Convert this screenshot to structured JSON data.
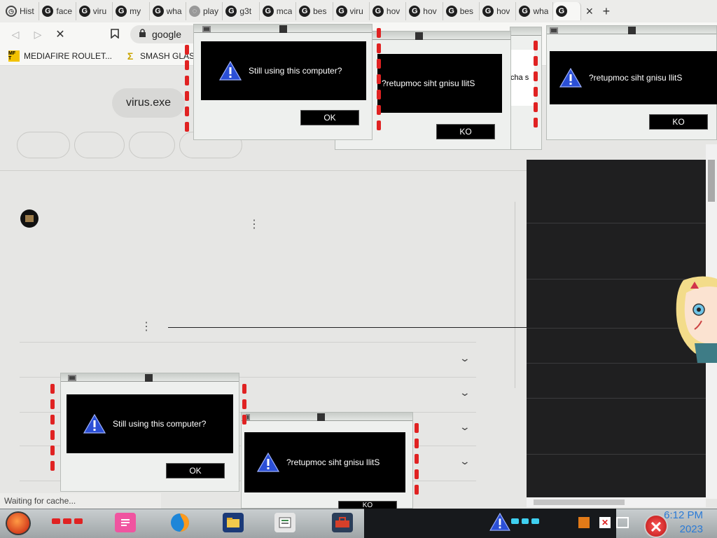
{
  "tabs": [
    {
      "label": "Hist",
      "icon": "history-icon"
    },
    {
      "label": "face",
      "icon": "google-icon"
    },
    {
      "label": "viru",
      "icon": "google-icon"
    },
    {
      "label": "my",
      "icon": "google-icon"
    },
    {
      "label": "wha",
      "icon": "google-icon"
    },
    {
      "label": "play",
      "icon": "loading-icon"
    },
    {
      "label": "g3t",
      "icon": "google-icon"
    },
    {
      "label": "mca",
      "icon": "google-icon"
    },
    {
      "label": "bes",
      "icon": "google-icon"
    },
    {
      "label": "viru",
      "icon": "google-icon"
    },
    {
      "label": "hov",
      "icon": "google-icon"
    },
    {
      "label": "hov",
      "icon": "google-icon"
    },
    {
      "label": "bes",
      "icon": "google-icon"
    },
    {
      "label": "hov",
      "icon": "google-icon"
    },
    {
      "label": "wha",
      "icon": "google-icon"
    }
  ],
  "active_tab": {
    "icon": "google-icon"
  },
  "tab_close": "×",
  "new_tab": "+",
  "toolbar": {
    "back": "◁",
    "forward": "▷",
    "stop": "✕",
    "bookmark": "🔖",
    "url": "google"
  },
  "bookmarks": [
    {
      "label": "MEDIAFIRE ROULET...",
      "badge": "MF T"
    },
    {
      "label": "SMASH GLAS",
      "badge": "Σ"
    }
  ],
  "page": {
    "chip": "virus.exe",
    "kebab": "⋮",
    "chevron": "⌄",
    "status": "Waiting for cache...",
    "partial_text": "cha s"
  },
  "dialogs": {
    "normal_message": "Still using this computer?",
    "mirrored_message": "?retupmoc siht gnisu llitS",
    "ok": "OK",
    "ko": "KO"
  },
  "taskbar": {
    "time": "6:12 PM",
    "year": "2023"
  },
  "colors": {
    "accent_red": "#e02222",
    "clock_blue": "#2a7ad6",
    "panel_dark": "#1f1f20"
  }
}
